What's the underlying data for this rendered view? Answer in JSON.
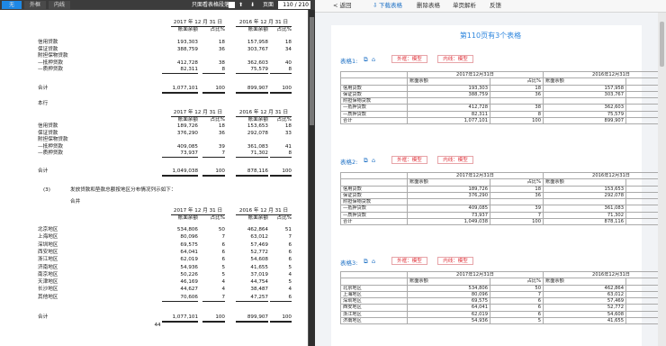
{
  "pdf_toolbar": {
    "toggles": [
      "无",
      "外框",
      "内线"
    ],
    "mode_label": "只面看表格段落",
    "page_label": "页面",
    "page_value": "110 / 210"
  },
  "pdf_page": {
    "page_number": "44",
    "col_2017": "2017 年 12 月 31 日",
    "col_2016": "2016 年 12 月 31 日",
    "sub_amount": "账面余额",
    "sub_pct": "占比%",
    "t1": {
      "rows": [
        [
          "信用贷款",
          "193,303",
          "18",
          "157,958",
          "18"
        ],
        [
          "保证贷款",
          "388,759",
          "36",
          "303,767",
          "34"
        ],
        [
          "附担保物贷款",
          "",
          "",
          "",
          ""
        ],
        [
          "—抵押贷款",
          "412,728",
          "38",
          "362,603",
          "40"
        ],
        [
          "—质押贷款",
          "82,311",
          "8",
          "75,579",
          "8"
        ]
      ],
      "total_label": "合计",
      "total": [
        "1,077,101",
        "100",
        "899,907",
        "100"
      ]
    },
    "section_bank": "本行",
    "t2": {
      "rows": [
        [
          "信用贷款",
          "189,726",
          "18",
          "153,653",
          "18"
        ],
        [
          "保证贷款",
          "376,290",
          "36",
          "292,078",
          "33"
        ],
        [
          "附担保物贷款",
          "",
          "",
          "",
          ""
        ],
        [
          "—抵押贷款",
          "409,085",
          "39",
          "361,083",
          "41"
        ],
        [
          "—质押贷款",
          "73,937",
          "7",
          "71,302",
          "8"
        ]
      ],
      "total_label": "合计",
      "total": [
        "1,049,038",
        "100",
        "878,116",
        "100"
      ]
    },
    "item3_no": "(3)",
    "item3_text": "发放贷款和垫款总额按地区分布情况列示如下：",
    "section_group": "合并",
    "t3": {
      "rows": [
        [
          "北京地区",
          "534,806",
          "50",
          "462,864",
          "51"
        ],
        [
          "上海地区",
          "80,096",
          "7",
          "63,012",
          "7"
        ],
        [
          "深圳地区",
          "69,575",
          "6",
          "57,469",
          "6"
        ],
        [
          "西安地区",
          "64,041",
          "6",
          "52,772",
          "6"
        ],
        [
          "浙江地区",
          "62,019",
          "6",
          "54,608",
          "6"
        ],
        [
          "济南地区",
          "54,936",
          "5",
          "41,655",
          "5"
        ],
        [
          "南京地区",
          "50,226",
          "5",
          "37,019",
          "4"
        ],
        [
          "天津地区",
          "46,169",
          "4",
          "44,754",
          "5"
        ],
        [
          "长沙地区",
          "44,627",
          "4",
          "38,487",
          "4"
        ],
        [
          "其他地区",
          "70,606",
          "7",
          "47,257",
          "6"
        ]
      ],
      "total_label": "合计",
      "total": [
        "1,077,101",
        "100",
        "899,907",
        "100"
      ]
    }
  },
  "right_panel": {
    "toolbar": {
      "back": "< 返回",
      "download": "下载表格",
      "delete": "删除表格",
      "single_page": "单页解析",
      "feedback": "反馈"
    },
    "doc_title": "第110页有3个表格",
    "tables": [
      {
        "label": "表格1:",
        "btn_outer": "外框：模型",
        "btn_inner": "内线：模型",
        "hdr_2017": "2017年12月31日",
        "hdr_2016": "2016年12月31日",
        "sub": [
          "账面余额",
          "占比%",
          "账面余额",
          "占比%"
        ],
        "rows": [
          [
            "信用贷款",
            "193,303",
            "18",
            "157,958",
            "18"
          ],
          [
            "保证贷款",
            "388,759",
            "36",
            "303,767",
            "34"
          ],
          [
            "附担保物贷款",
            "",
            "",
            "",
            ""
          ],
          [
            "—抵押贷款",
            "412,728",
            "38",
            "362,603",
            "40"
          ],
          [
            "—质押贷款",
            "82,311",
            "8",
            "75,579",
            "8"
          ],
          [
            "合计",
            "1,077,101",
            "100",
            "899,907",
            "100"
          ]
        ]
      },
      {
        "label": "表格2:",
        "btn_outer": "外框：模型",
        "btn_inner": "内线：模型",
        "hdr_2017": "2017年12月31日",
        "hdr_2016": "2016年12月31日",
        "sub": [
          "账面余额",
          "占比%",
          "账面余额",
          "占比%"
        ],
        "rows": [
          [
            "信用贷款",
            "189,726",
            "18",
            "153,653",
            "18"
          ],
          [
            "保证贷款",
            "376,290",
            "36",
            "292,078",
            "33"
          ],
          [
            "附担保物贷款",
            "",
            "",
            "",
            ""
          ],
          [
            "—抵押贷款",
            "409,085",
            "39",
            "361,083",
            "41"
          ],
          [
            "—质押贷款",
            "73,937",
            "7",
            "71,302",
            "8"
          ],
          [
            "合计",
            "1,049,038",
            "100",
            "878,116",
            "100"
          ]
        ]
      },
      {
        "label": "表格3:",
        "btn_outer": "外框：模型",
        "btn_inner": "内线：模型",
        "hdr_2017": "2017年12月31日",
        "hdr_2016": "2016年12月31日",
        "sub": [
          "账面余额",
          "占比%",
          "账面余额",
          "占比%"
        ],
        "rows": [
          [
            "北京地区",
            "534,806",
            "50",
            "462,864",
            "51"
          ],
          [
            "上海地区",
            "80,096",
            "7",
            "63,012",
            "7"
          ],
          [
            "深圳地区",
            "69,575",
            "6",
            "57,469",
            "6"
          ],
          [
            "西安地区",
            "64,041",
            "6",
            "52,772",
            "6"
          ],
          [
            "浙江地区",
            "62,019",
            "6",
            "54,608",
            "6"
          ],
          [
            "济南地区",
            "54,936",
            "5",
            "41,655",
            "5"
          ]
        ]
      }
    ]
  },
  "colors": {
    "accent_blue": "#1b6fc4",
    "tag_red": "#e0343c",
    "toggle_active": "#1e88e5"
  }
}
